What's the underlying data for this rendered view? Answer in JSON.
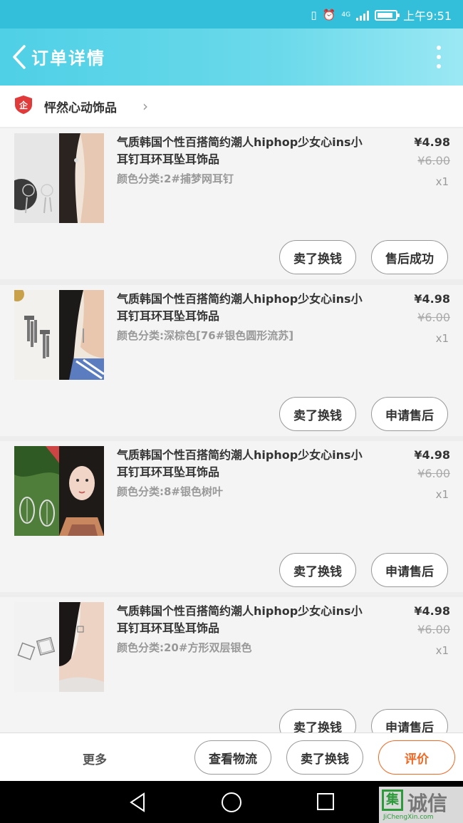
{
  "status_bar": {
    "network": "4G",
    "time": "上午9:51"
  },
  "header": {
    "title": "订单详情"
  },
  "shop": {
    "name": "怦然心动饰品",
    "logo_glyph": "企"
  },
  "items": [
    {
      "title": "气质韩国个性百搭简约潮人hiphop少女心ins小耳钉耳环耳坠耳饰品",
      "variant": "颜色分类:2#捕梦网耳钉",
      "price": "¥4.98",
      "original_price": "¥6.00",
      "quantity": "x1",
      "button_a": "卖了换钱",
      "button_b": "售后成功"
    },
    {
      "title": "气质韩国个性百搭简约潮人hiphop少女心ins小耳钉耳环耳坠耳饰品",
      "variant": "颜色分类:深棕色[76#银色圆形流苏]",
      "price": "¥4.98",
      "original_price": "¥6.00",
      "quantity": "x1",
      "button_a": "卖了换钱",
      "button_b": "申请售后"
    },
    {
      "title": "气质韩国个性百搭简约潮人hiphop少女心ins小耳钉耳环耳坠耳饰品",
      "variant": "颜色分类:8#银色树叶",
      "price": "¥4.98",
      "original_price": "¥6.00",
      "quantity": "x1",
      "button_a": "卖了换钱",
      "button_b": "申请售后"
    },
    {
      "title": "气质韩国个性百搭简约潮人hiphop少女心ins小耳钉耳环耳坠耳饰品",
      "variant": "颜色分类:20#方形双层银色",
      "price": "¥4.98",
      "original_price": "¥6.00",
      "quantity": "x1",
      "button_a": "卖了换钱",
      "button_b": "申请售后"
    }
  ],
  "action_bar": {
    "more": "更多",
    "logistics": "查看物流",
    "sell": "卖了换钱",
    "review": "评价"
  },
  "watermark": {
    "text": "诚信",
    "box_glyph": "集",
    "url": "JiChengXin.com"
  },
  "colors": {
    "accent": "#4fd0e6",
    "review": "#f26722"
  }
}
